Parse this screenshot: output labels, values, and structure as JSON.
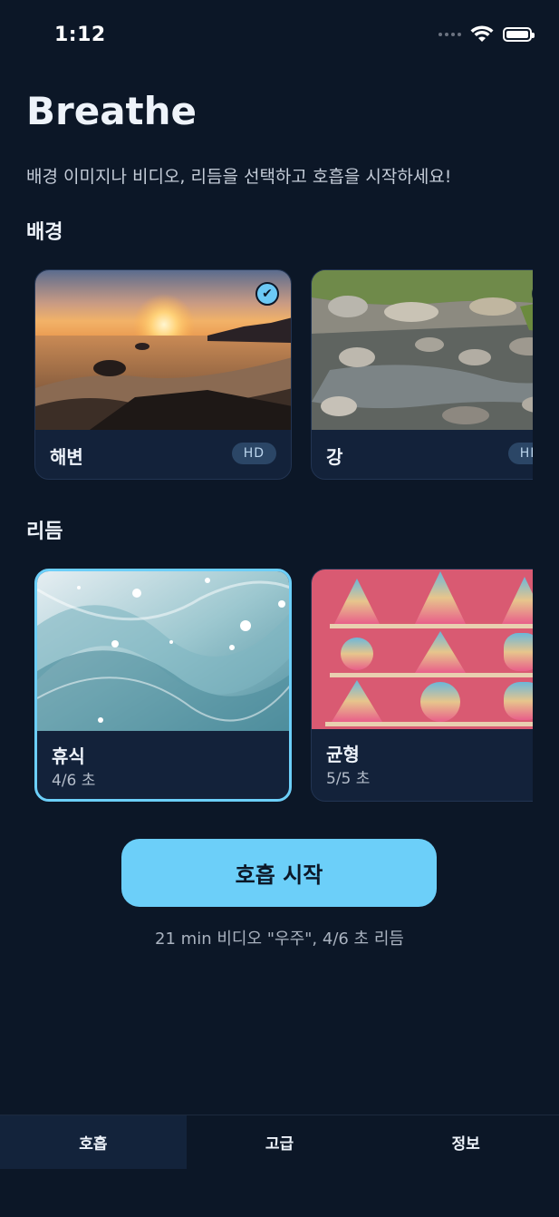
{
  "status": {
    "time": "1:12",
    "icons": [
      "signal-dots-icon",
      "wifi-icon",
      "battery-icon"
    ]
  },
  "header": {
    "title": "Breathe",
    "subtitle": "배경 이미지나 비디오, 리듬을 선택하고 호흡을 시작하세요!"
  },
  "backgrounds": {
    "heading": "배경",
    "items": [
      {
        "label": "해변",
        "badge": "HD",
        "selected": true
      },
      {
        "label": "강",
        "badge": "HD",
        "selected": false
      }
    ]
  },
  "rhythms": {
    "heading": "리듬",
    "items": [
      {
        "label": "휴식",
        "sub": "4/6 초",
        "selected": true
      },
      {
        "label": "균형",
        "sub": "5/5 초",
        "selected": false
      }
    ]
  },
  "action": {
    "start_label": "호흡 시작",
    "summary": "21 min 비디오 \"우주\", 4/6 초 리듬"
  },
  "tabs": [
    {
      "label": "호흡",
      "active": true
    },
    {
      "label": "고급",
      "active": false
    },
    {
      "label": "정보",
      "active": false
    }
  ],
  "colors": {
    "background": "#0c1727",
    "accent": "#6ccff9",
    "card": "#13223a"
  }
}
